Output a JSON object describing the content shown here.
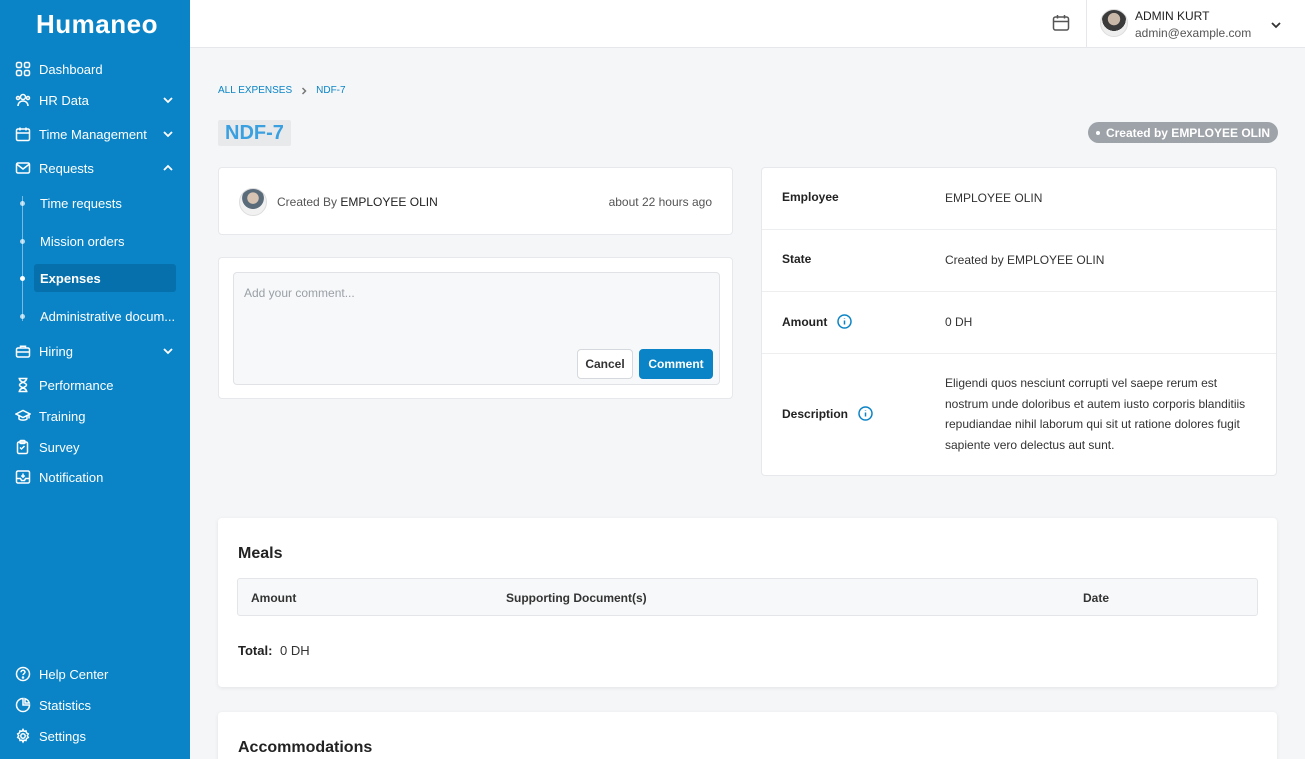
{
  "brand": "Humaneo",
  "sidebar": {
    "items": [
      {
        "label": "Dashboard",
        "icon": "grid-icon"
      },
      {
        "label": "HR Data",
        "icon": "users-icon"
      },
      {
        "label": "Time Management",
        "icon": "calendar-icon"
      },
      {
        "label": "Requests",
        "icon": "mail-icon"
      },
      {
        "label": "Hiring",
        "icon": "briefcase-icon"
      },
      {
        "label": "Performance",
        "icon": "hourglass-icon"
      },
      {
        "label": "Training",
        "icon": "graduation-icon"
      },
      {
        "label": "Survey",
        "icon": "clipboard-icon"
      },
      {
        "label": "Notification",
        "icon": "inbox-icon"
      }
    ],
    "request_subitems": [
      {
        "label": "Time requests"
      },
      {
        "label": "Mission orders"
      },
      {
        "label": "Expenses"
      },
      {
        "label": "Administrative docum..."
      }
    ],
    "footer_items": [
      {
        "label": "Help Center",
        "icon": "help-icon"
      },
      {
        "label": "Statistics",
        "icon": "chart-icon"
      },
      {
        "label": "Settings",
        "icon": "gear-icon"
      }
    ]
  },
  "header": {
    "user_name": "ADMIN KURT",
    "user_email": "admin@example.com"
  },
  "breadcrumb": {
    "root": "ALL EXPENSES",
    "current": "NDF-7"
  },
  "page": {
    "title": "NDF-7",
    "state_badge": "Created by EMPLOYEE OLIN"
  },
  "creator": {
    "prefix": "Created By",
    "name": "EMPLOYEE OLIN",
    "time": "about 22 hours ago"
  },
  "comment": {
    "placeholder": "Add your comment...",
    "cancel_label": "Cancel",
    "submit_label": "Comment"
  },
  "details": {
    "employee_label": "Employee",
    "employee_value": "EMPLOYEE OLIN",
    "state_label": "State",
    "state_value": "Created by EMPLOYEE OLIN",
    "amount_label": "Amount",
    "amount_value": "0 DH",
    "description_label": "Description",
    "description_value": "Eligendi quos nesciunt corrupti vel saepe rerum est nostrum unde doloribus et autem iusto corporis blanditiis repudiandae nihil laborum qui sit ut ratione dolores fugit sapiente vero delectus aut sunt."
  },
  "meals": {
    "title": "Meals",
    "columns": [
      "Amount",
      "Supporting Document(s)",
      "Date"
    ],
    "total_label": "Total:",
    "total_value": "0 DH"
  },
  "accommodations": {
    "title": "Accommodations"
  }
}
